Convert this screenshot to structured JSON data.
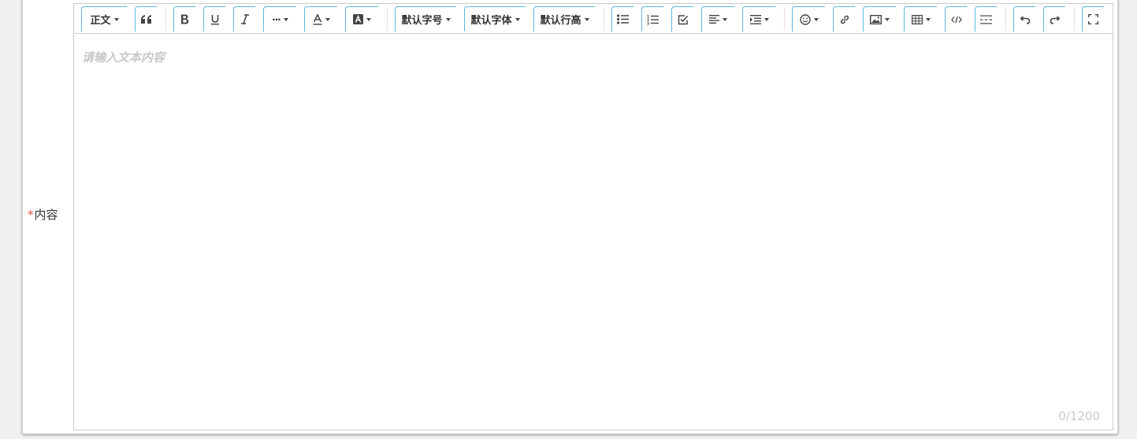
{
  "form": {
    "required_mark": "*",
    "content_label": "内容"
  },
  "toolbar": {
    "heading_select": "正文",
    "font_size_select": "默认字号",
    "font_family_select": "默认字体",
    "line_height_select": "默认行高",
    "more_label": "···",
    "icons": [
      "blockquote-icon",
      "bold-icon",
      "underline-icon",
      "italic-icon",
      "more-icon",
      "font-color-icon",
      "background-color-icon",
      "bulleted-list-icon",
      "numbered-list-icon",
      "todo-icon",
      "align-icon",
      "indent-icon",
      "emotion-icon",
      "link-icon",
      "image-icon",
      "table-icon",
      "code-icon",
      "divider-icon",
      "undo-icon",
      "redo-icon",
      "fullscreen-icon"
    ]
  },
  "editor": {
    "placeholder": "请输入文本内容",
    "counter": "0/1200"
  },
  "colors": {
    "accent_border": "#5bb7e0",
    "required": "#e54d42",
    "placeholder": "#c8c8c8"
  }
}
